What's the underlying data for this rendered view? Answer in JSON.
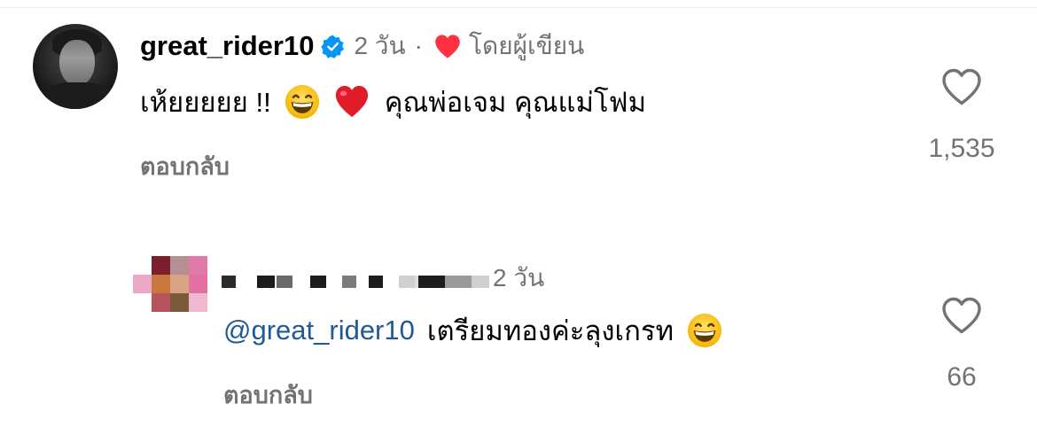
{
  "comment": {
    "username": "great_rider10",
    "time": "2 วัน",
    "separator": "·",
    "liked_by_author": "โดยผู้เขียน",
    "text": "เห้ยยยยย !!",
    "text_after_emoji": "คุณพ่อเจม คุณแม่โฟม",
    "emojis": [
      "grinning-face-emoji",
      "red-heart-emoji"
    ],
    "reply_label": "ตอบกลับ",
    "like_count": "1,535"
  },
  "reply": {
    "time": "2 วัน",
    "mention": "@great_rider10",
    "text": "เตรียมทองค่ะลุงเกรท",
    "emoji": "grinning-face-emoji",
    "reply_label": "ตอบกลับ",
    "like_count": "66"
  },
  "colors": {
    "secondary_text": "#737373",
    "mention": "#1f5a96",
    "verified": "#0095f6",
    "heart": "#ff3040"
  }
}
